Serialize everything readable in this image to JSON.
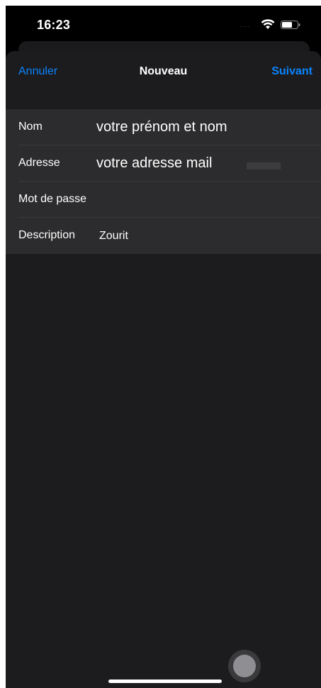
{
  "status_bar": {
    "time": "16:23",
    "signal_dots": "....",
    "wifi_icon": "wifi-icon",
    "battery_icon": "battery-icon"
  },
  "nav": {
    "cancel_label": "Annuler",
    "title": "Nouveau",
    "next_label": "Suivant",
    "accent_color": "#0a84ff"
  },
  "form": {
    "rows": [
      {
        "label": "Nom",
        "value": "votre prénom et nom"
      },
      {
        "label": "Adresse",
        "value": "votre adresse mail"
      },
      {
        "label": "Mot de passe",
        "value": ""
      },
      {
        "label": "Description",
        "value": "Zourit"
      }
    ]
  },
  "colors": {
    "background": "#000000",
    "sheet": "#1c1c1e",
    "form_row": "#2c2c2e",
    "separator": "#3a3a3c"
  }
}
